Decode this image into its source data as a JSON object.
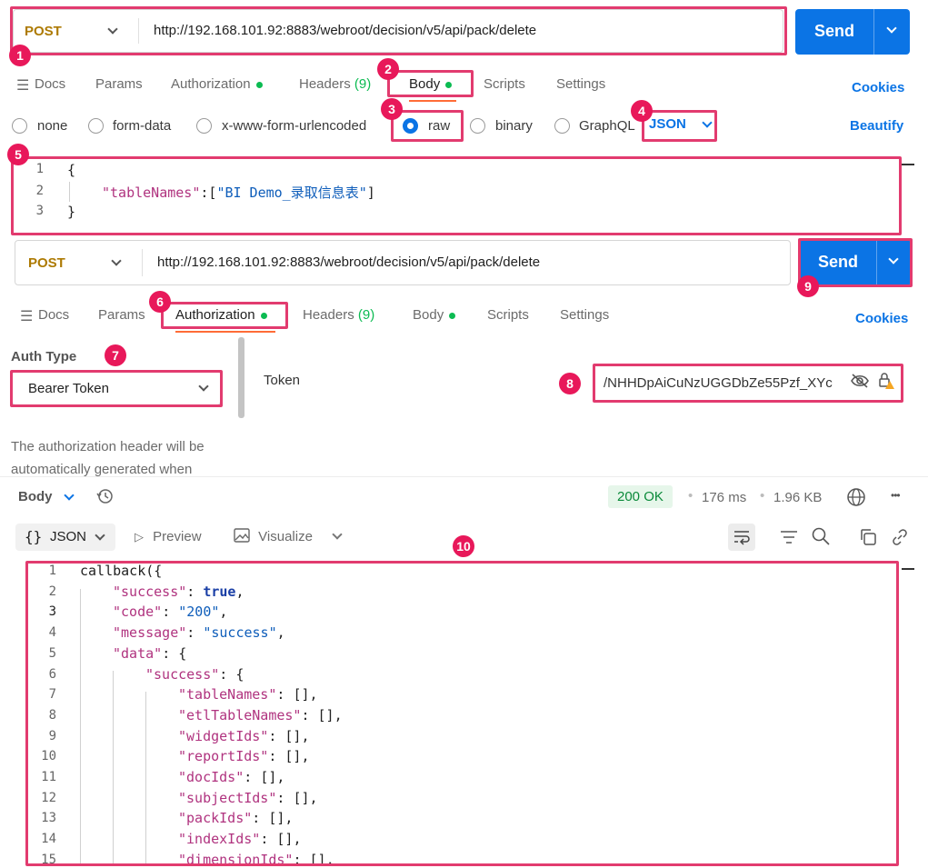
{
  "panel1": {
    "method": "POST",
    "url": "http://192.168.101.92:8883/webroot/decision/v5/api/pack/delete",
    "send_label": "Send",
    "tabs": [
      {
        "label": "Docs"
      },
      {
        "label": "Params"
      },
      {
        "label": "Authorization"
      },
      {
        "label": "Headers",
        "count": "(9)"
      },
      {
        "label": "Body"
      },
      {
        "label": "Scripts"
      },
      {
        "label": "Settings"
      }
    ],
    "cookies": "Cookies",
    "body_types": [
      "none",
      "form-data",
      "x-www-form-urlencoded",
      "raw",
      "binary",
      "GraphQL"
    ],
    "format": "JSON",
    "beautify": "Beautify",
    "code": {
      "line_numbers": [
        "1",
        "2",
        "3"
      ],
      "open": "{",
      "key": "\"tableNames\"",
      "colon": ":[",
      "value": "\"BI Demo_录取信息表\"",
      "close_bracket": "]",
      "close": "}"
    }
  },
  "panel2": {
    "method": "POST",
    "url": "http://192.168.101.92:8883/webroot/decision/v5/api/pack/delete",
    "send_label": "Send",
    "tabs": [
      {
        "label": "Docs"
      },
      {
        "label": "Params"
      },
      {
        "label": "Authorization"
      },
      {
        "label": "Headers",
        "count": "(9)"
      },
      {
        "label": "Body"
      },
      {
        "label": "Scripts"
      },
      {
        "label": "Settings"
      }
    ],
    "cookies": "Cookies",
    "auth_type_label": "Auth Type",
    "auth_type_value": "Bearer Token",
    "auth_desc_1": "The authorization header will be",
    "auth_desc_2": "automatically generated when",
    "token_label": "Token",
    "token_value": "/NHHDpAiCuNzUGGDbZe55Pzf_XYc"
  },
  "response": {
    "body_label": "Body",
    "status": "200 OK",
    "time": "176 ms",
    "size": "1.96 KB",
    "more": "•••",
    "format": "JSON",
    "format_icon": "{}",
    "preview": "Preview",
    "visualize": "Visualize",
    "lines": [
      {
        "n": "1",
        "text": "callback({"
      },
      {
        "n": "2",
        "key": "\"success\"",
        "val": "true",
        "vt": "b",
        "end": ","
      },
      {
        "n": "3",
        "key": "\"code\"",
        "val": "\"200\"",
        "vt": "s",
        "end": ","
      },
      {
        "n": "4",
        "key": "\"message\"",
        "val": "\"success\"",
        "vt": "s",
        "end": ","
      },
      {
        "n": "5",
        "key": "\"data\"",
        "val": "{",
        "vt": "p",
        "end": ""
      },
      {
        "n": "6",
        "key": "\"success\"",
        "val": "{",
        "vt": "p",
        "end": ""
      },
      {
        "n": "7",
        "key": "\"tableNames\"",
        "val": "[]",
        "vt": "p",
        "end": ","
      },
      {
        "n": "8",
        "key": "\"etlTableNames\"",
        "val": "[]",
        "vt": "p",
        "end": ","
      },
      {
        "n": "9",
        "key": "\"widgetIds\"",
        "val": "[]",
        "vt": "p",
        "end": ","
      },
      {
        "n": "10",
        "key": "\"reportIds\"",
        "val": "[]",
        "vt": "p",
        "end": ","
      },
      {
        "n": "11",
        "key": "\"docIds\"",
        "val": "[]",
        "vt": "p",
        "end": ","
      },
      {
        "n": "12",
        "key": "\"subjectIds\"",
        "val": "[]",
        "vt": "p",
        "end": ","
      },
      {
        "n": "13",
        "key": "\"packIds\"",
        "val": "[]",
        "vt": "p",
        "end": ","
      },
      {
        "n": "14",
        "key": "\"indexIds\"",
        "val": "[]",
        "vt": "p",
        "end": ","
      },
      {
        "n": "15",
        "key": "\"dimensionIds\"",
        "val": "[]",
        "vt": "p",
        "end": ","
      }
    ]
  },
  "annotations": [
    "1",
    "2",
    "3",
    "4",
    "5",
    "6",
    "7",
    "8",
    "9",
    "10"
  ],
  "colors": {
    "accent": "#0b74e5",
    "annotation": "#e23b6f",
    "method": "#ad7a03",
    "status_ok": "#0cbb52"
  }
}
